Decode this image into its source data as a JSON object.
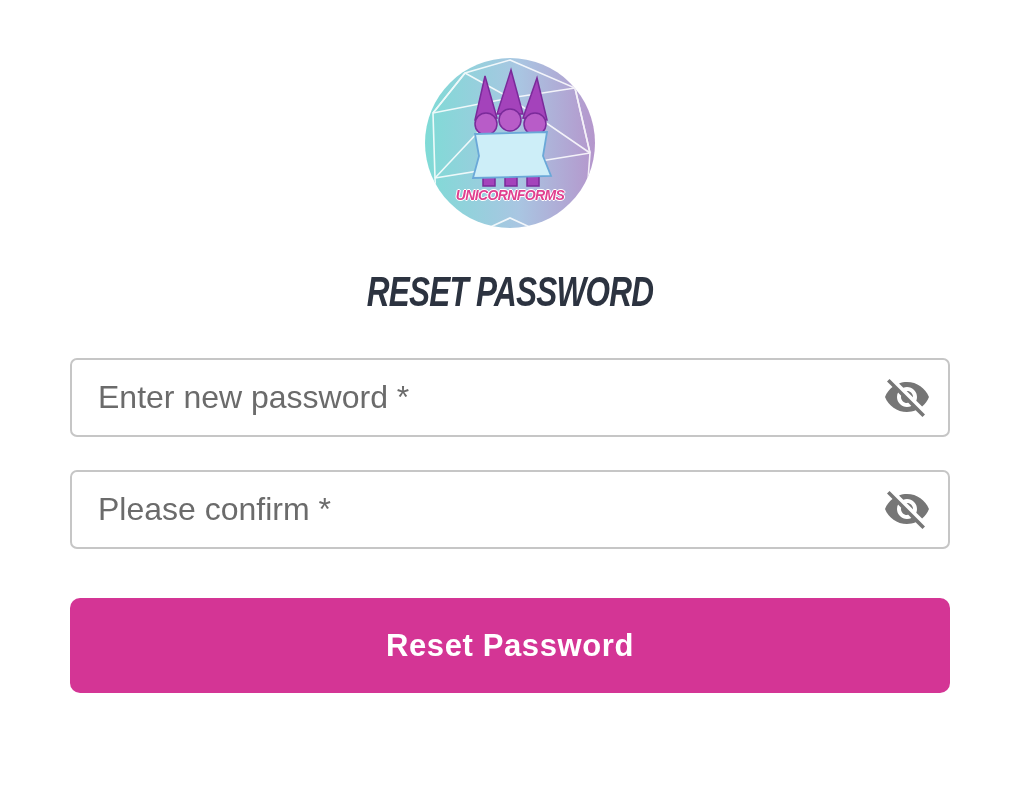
{
  "logo": {
    "text": "UNICORNFORMS"
  },
  "title": "RESET PASSWORD",
  "fields": [
    {
      "placeholder": "Enter new password *",
      "password_visible": false
    },
    {
      "placeholder": "Please confirm *",
      "password_visible": false
    }
  ],
  "submit_button": {
    "label": "Reset Password"
  }
}
